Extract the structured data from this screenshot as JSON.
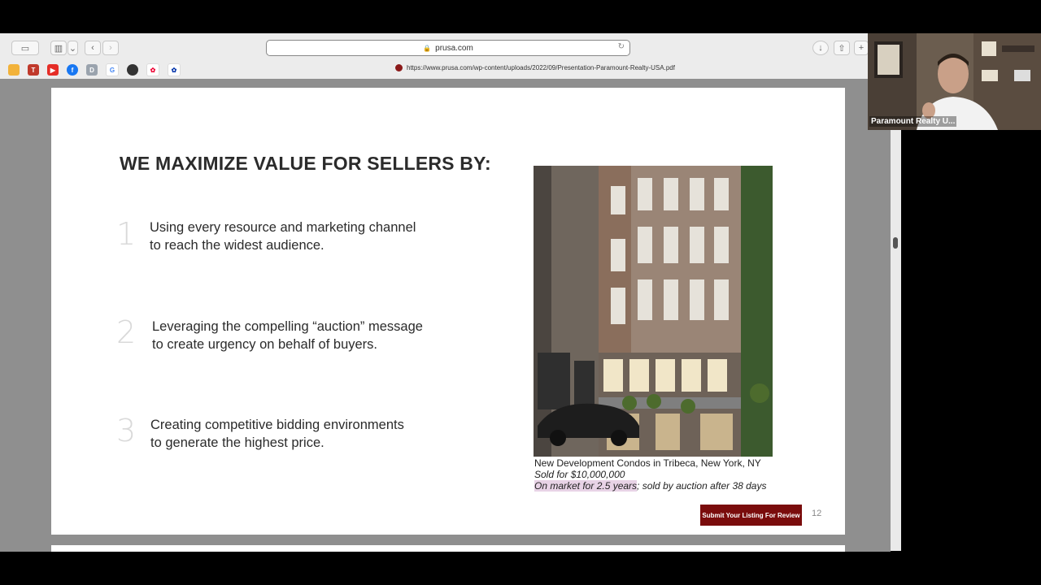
{
  "browser": {
    "address": "prusa.com",
    "tab_url": "https://www.prusa.com/wp-content/uploads/2022/09/Presentation-Paramount-Realty-USA.pdf",
    "favicons": [
      "apple-icon",
      "app-icon",
      "youtube-icon",
      "facebook-icon",
      "docs-icon",
      "google-icon",
      "github-icon",
      "nbc-icon",
      "nbc-icon"
    ]
  },
  "slide": {
    "heading": "WE MAXIMIZE VALUE FOR SELLERS BY:",
    "items": [
      {
        "num": "1",
        "text": "Using every resource and marketing channel\nto reach the widest audience."
      },
      {
        "num": "2",
        "text": "Leveraging the compelling “auction” message\nto create urgency on behalf of buyers."
      },
      {
        "num": "3",
        "text": "Creating competitive bidding environments\nto generate the highest price."
      }
    ],
    "caption_title": "New Development Condos in Tribeca, New York, NY",
    "caption_sold": "Sold for $10,000,000",
    "caption_market_hl": "On market for 2.5 years",
    "caption_market_rest": "; sold by auction after 38 days",
    "cta": "Submit Your Listing For Review",
    "page_number": "12"
  },
  "video": {
    "name": "Paramount Realty U..."
  },
  "colors": {
    "brand": "#7a0c0c",
    "highlight": "#e8d3e6"
  }
}
